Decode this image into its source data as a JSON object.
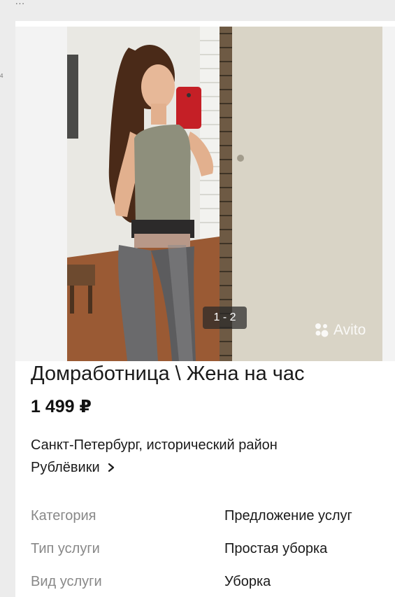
{
  "page": {
    "top_ellipsis": "...",
    "side_mark": "4"
  },
  "gallery": {
    "counter": "1 - 2",
    "watermark": "Avito",
    "photo_icon": "selfie-photo"
  },
  "listing": {
    "title": "Домработница \\ Жена на час",
    "price": "1 499 ₽",
    "address_line1": "Санкт-Петербург, исторический район",
    "address_line2": "Рублёвики",
    "address_icon": "chevron-right-icon"
  },
  "params": [
    {
      "label": "Категория",
      "value": "Предложение услуг"
    },
    {
      "label": "Тип услуги",
      "value": "Простая уборка"
    },
    {
      "label": "Вид услуги",
      "value": "Уборка"
    }
  ],
  "colors": {
    "background": "#ececec",
    "card": "#ffffff",
    "label_gray": "#888888",
    "text": "#1a1a1a"
  }
}
